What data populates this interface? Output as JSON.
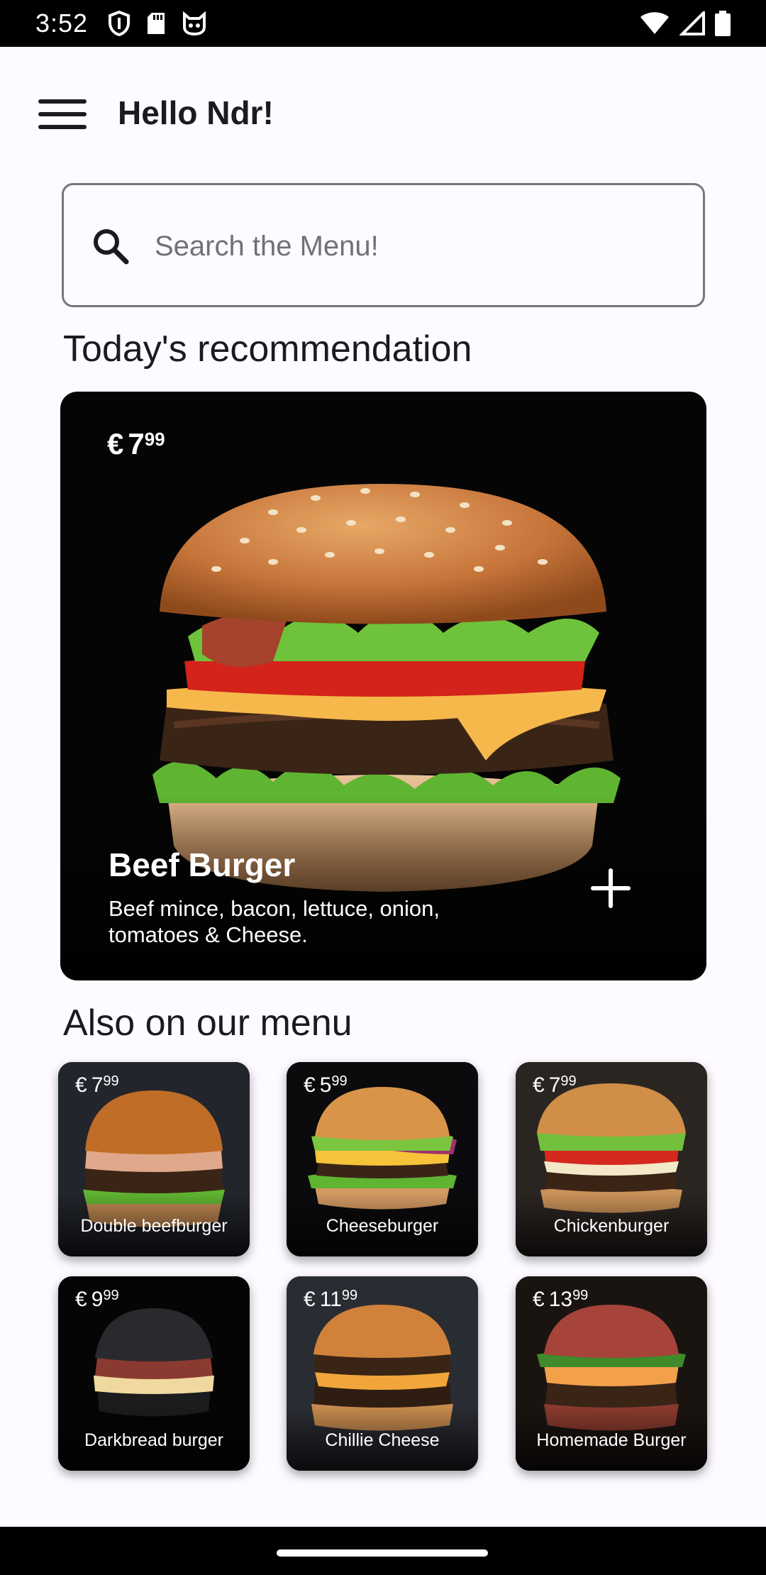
{
  "status_bar": {
    "time": "3:52",
    "left_icons": [
      "shield-icon",
      "sd-card-icon",
      "cat-face-icon"
    ],
    "right_icons": [
      "wifi-icon",
      "signal-icon",
      "battery-icon"
    ]
  },
  "header": {
    "greeting": "Hello Ndr!",
    "menu_icon": "hamburger-menu-icon"
  },
  "search": {
    "placeholder": "Search the Menu!",
    "value": ""
  },
  "recommendation": {
    "section_title": "Today's recommendation",
    "price_currency": "€",
    "price_whole": "7",
    "price_cents": "99",
    "name": "Beef Burger",
    "description": "Beef mince, bacon, lettuce, onion, tomatoes & Cheese.",
    "add_icon": "plus-icon"
  },
  "menu": {
    "section_title": "Also on our menu",
    "items": [
      {
        "name": "Double beefburger",
        "currency": "€",
        "whole": "7",
        "cents": "99"
      },
      {
        "name": "Cheeseburger",
        "currency": "€",
        "whole": "5",
        "cents": "99"
      },
      {
        "name": "Chickenburger",
        "currency": "€",
        "whole": "7",
        "cents": "99"
      },
      {
        "name": "Darkbread burger",
        "currency": "€",
        "whole": "9",
        "cents": "99"
      },
      {
        "name": "Chillie Cheese",
        "currency": "€",
        "whole": "11",
        "cents": "99"
      },
      {
        "name": "Homemade Burger",
        "currency": "€",
        "whole": "13",
        "cents": "99"
      }
    ]
  },
  "colors": {
    "background": "#fdfbff",
    "card_background": "#050505",
    "text_primary": "#1b1b1f",
    "outline": "#74777f"
  }
}
